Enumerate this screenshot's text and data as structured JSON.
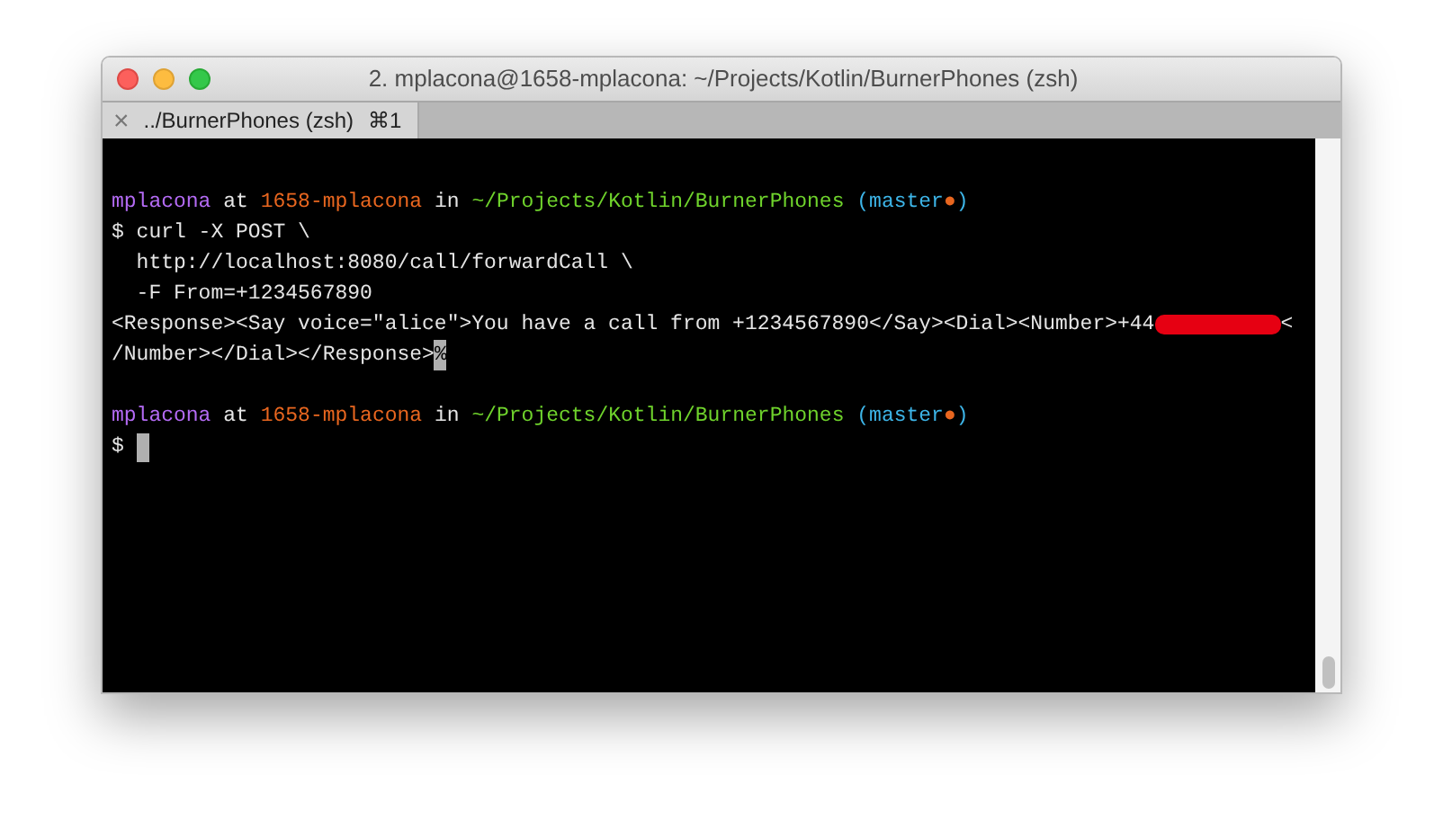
{
  "window": {
    "title": "2. mplacona@1658-mplacona: ~/Projects/Kotlin/BurnerPhones (zsh)"
  },
  "tabs": [
    {
      "close": "×",
      "label": "../BurnerPhones (zsh)",
      "shortcut": "⌘1",
      "selected": true
    }
  ],
  "terminal": {
    "lines": [
      {
        "kind": "blank"
      },
      {
        "kind": "prompt",
        "user": "mplacona",
        "at": "at",
        "host": "1658-mplacona",
        "in": "in",
        "path": "~/Projects/Kotlin/BurnerPhones",
        "branch_open": "(master",
        "dirty": "●",
        "branch_close": ")"
      },
      {
        "kind": "text",
        "text": "$ curl -X POST \\"
      },
      {
        "kind": "text",
        "text": "  http://localhost:8080/call/forwardCall \\"
      },
      {
        "kind": "text",
        "text": "  -F From=+1234567890"
      },
      {
        "kind": "output",
        "text": "<Response><Say voice=\"alice\">You have a call from +1234567890</Say><Dial><Number>+44",
        "redacted": true,
        "after": "<"
      },
      {
        "kind": "output",
        "text": "/Number></Dial></Response>",
        "end_mark": "%"
      },
      {
        "kind": "blank"
      },
      {
        "kind": "prompt",
        "user": "mplacona",
        "at": "at",
        "host": "1658-mplacona",
        "in": "in",
        "path": "~/Projects/Kotlin/BurnerPhones",
        "branch_open": "(master",
        "dirty": "●",
        "branch_close": ")"
      },
      {
        "kind": "input",
        "text": "$",
        "cursor": true
      }
    ]
  }
}
